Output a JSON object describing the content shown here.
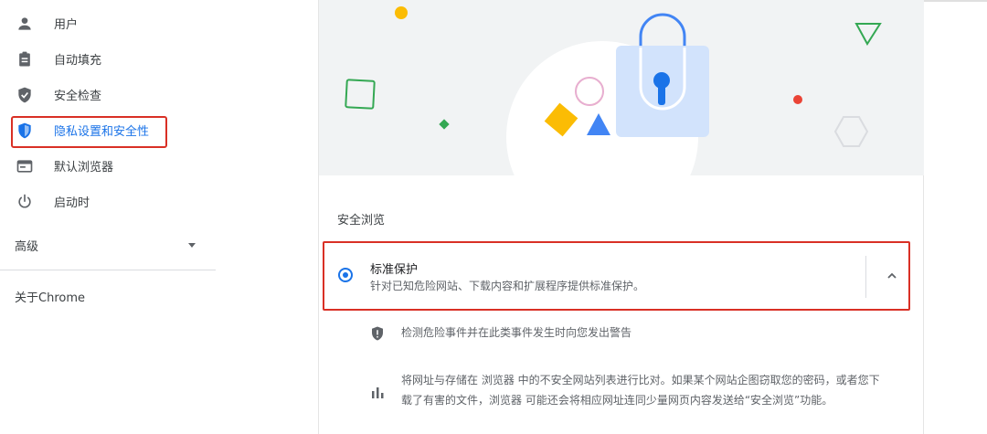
{
  "sidebar": {
    "items": [
      {
        "label": "用户",
        "icon": "person-icon"
      },
      {
        "label": "自动填充",
        "icon": "clipboard-icon"
      },
      {
        "label": "安全检查",
        "icon": "shield-check-icon"
      },
      {
        "label": "隐私设置和安全性",
        "icon": "shield-icon",
        "selected": true
      },
      {
        "label": "默认浏览器",
        "icon": "browser-icon"
      },
      {
        "label": "启动时",
        "icon": "power-icon"
      }
    ],
    "advanced_label": "高级",
    "about_label": "关于Chrome"
  },
  "main": {
    "section_title": "安全浏览",
    "option": {
      "title": "标准保护",
      "description": "针对已知危险网站、下载内容和扩展程序提供标准保护。",
      "selected": true
    },
    "details": [
      {
        "icon": "shield-alert-icon",
        "text": "检测危险事件并在此类事件发生时向您发出警告"
      },
      {
        "icon": "bar-chart-icon",
        "line1": "将网址与存储在 浏览器 中的不安全网站列表进行比对。如果某个网站企图窃取您的密码，或者您下",
        "line2": "载了有害的文件，浏览器 可能还会将相应网址连同少量网页内容发送给“安全浏览”功能。"
      }
    ]
  },
  "colors": {
    "accent": "#1a73e8",
    "highlight_border": "#d93025",
    "banner_bg": "#f1f3f4"
  }
}
